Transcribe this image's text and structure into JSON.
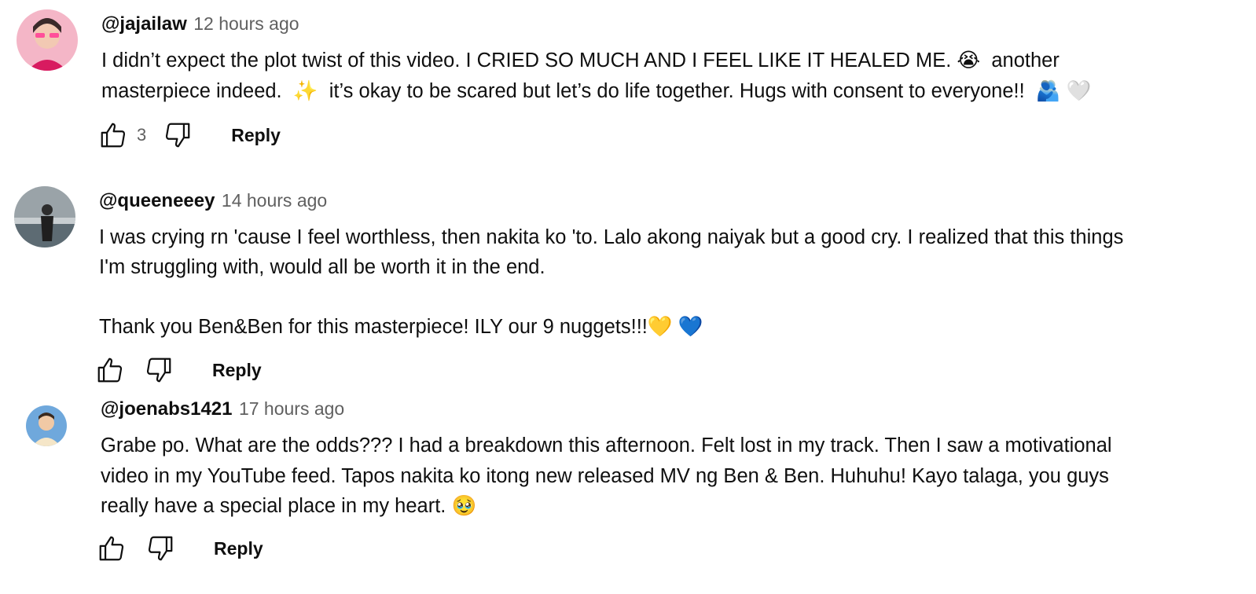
{
  "comments": [
    {
      "author": "@jajailaw",
      "time": "12 hours ago",
      "text": "I didn’t expect the plot twist of this video. I CRIED SO MUCH AND I FEEL LIKE IT HEALED ME. 😭  another\nmasterpiece indeed.  ✨  it’s okay to be scared but let’s do life together. Hugs with consent to everyone!!  🫂 🤍",
      "likes": "3",
      "reply_label": "Reply",
      "avatar_colors": {
        "bg": "#f4b6c7",
        "accent": "#d81b60"
      }
    },
    {
      "author": "@queeneeey",
      "time": "14 hours ago",
      "text": "I was crying rn 'cause I feel worthless, then nakita ko 'to. Lalo akong naiyak but a good cry. I realized that this things\nI'm struggling with, would all be worth it in the end.\n\nThank you Ben&Ben for this masterpiece! ILY our 9 nuggets!!!💛 💙",
      "likes": "",
      "reply_label": "Reply",
      "avatar_colors": {
        "bg": "#8a9399",
        "accent": "#2d2d2d"
      }
    },
    {
      "author": "@joenabs1421",
      "time": "17 hours ago",
      "text": "Grabe po. What are the odds??? I had a breakdown this afternoon. Felt lost in my track. Then I saw a motivational\nvideo in my YouTube feed. Tapos nakita ko itong new released MV ng Ben & Ben. Huhuhu! Kayo talaga, you guys\nreally have a special place in my heart. 🥹",
      "likes": "",
      "reply_label": "Reply",
      "avatar_colors": {
        "bg": "#6fa8dc",
        "accent": "#f1c9a5"
      }
    }
  ]
}
